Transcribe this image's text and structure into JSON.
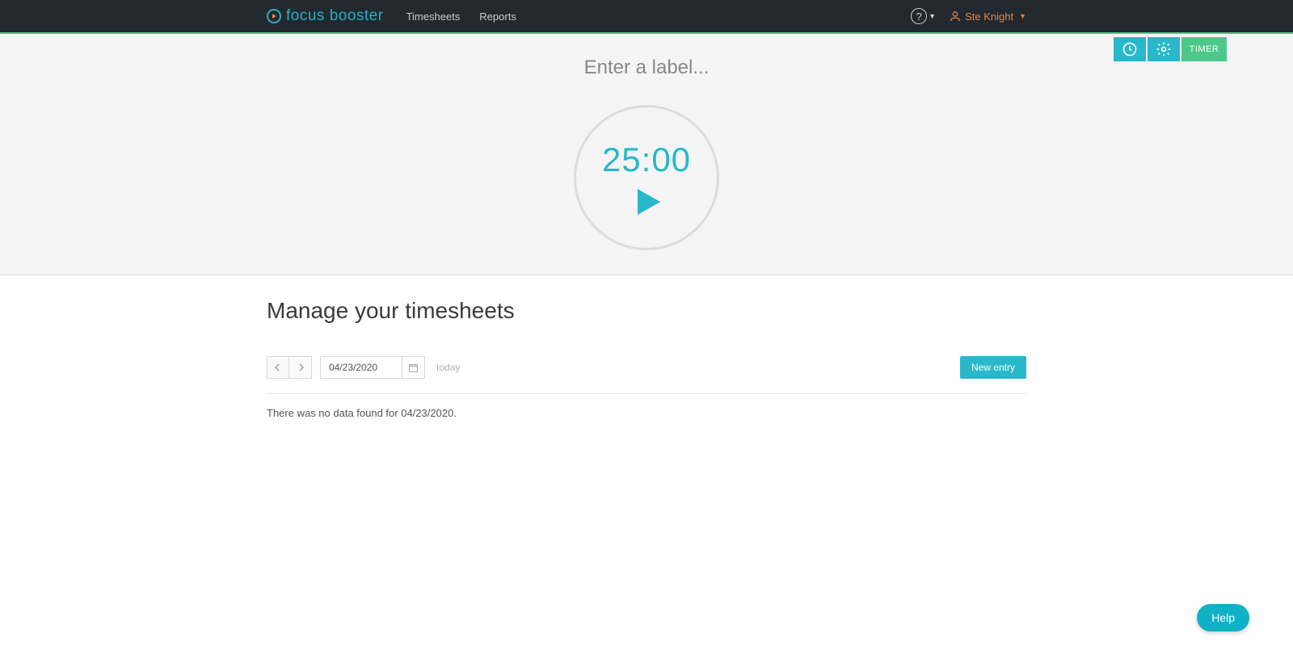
{
  "header": {
    "logo_text": "focus booster",
    "nav": [
      "Timesheets",
      "Reports"
    ],
    "help_glyph": "?",
    "user_name": "Ste Knight"
  },
  "timer_controls": {
    "timer_label": "TIMER"
  },
  "timer": {
    "label_placeholder": "Enter a label...",
    "time": "25:00"
  },
  "main": {
    "title": "Manage your timesheets",
    "date": "04/23/2020",
    "today_label": "today",
    "new_entry_label": "New entry",
    "no_data_msg": "There was no data found for 04/23/2020."
  },
  "help_bubble": "Help"
}
